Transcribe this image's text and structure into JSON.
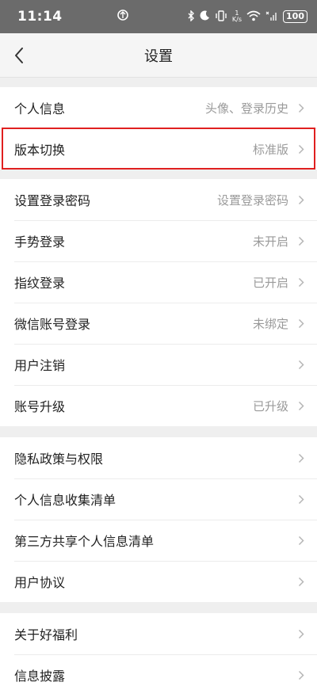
{
  "status": {
    "time": "11:14",
    "speed_top": "1",
    "speed_unit": "K/s",
    "battery": "100"
  },
  "nav": {
    "title": "设置"
  },
  "groups": [
    [
      {
        "label": "个人信息",
        "value": "头像、登录历史"
      },
      {
        "label": "版本切换",
        "value": "标准版"
      }
    ],
    [
      {
        "label": "设置登录密码",
        "value": "设置登录密码"
      },
      {
        "label": "手势登录",
        "value": "未开启"
      },
      {
        "label": "指纹登录",
        "value": "已开启"
      },
      {
        "label": "微信账号登录",
        "value": "未绑定"
      },
      {
        "label": "用户注销",
        "value": ""
      },
      {
        "label": "账号升级",
        "value": "已升级"
      }
    ],
    [
      {
        "label": "隐私政策与权限",
        "value": ""
      },
      {
        "label": "个人信息收集清单",
        "value": ""
      },
      {
        "label": "第三方共享个人信息清单",
        "value": ""
      },
      {
        "label": "用户协议",
        "value": ""
      }
    ],
    [
      {
        "label": "关于好福利",
        "value": ""
      },
      {
        "label": "信息披露",
        "value": ""
      }
    ]
  ],
  "colors": {
    "highlight": "#e02020",
    "background": "#efefef",
    "value_text": "#9a9a9a"
  }
}
